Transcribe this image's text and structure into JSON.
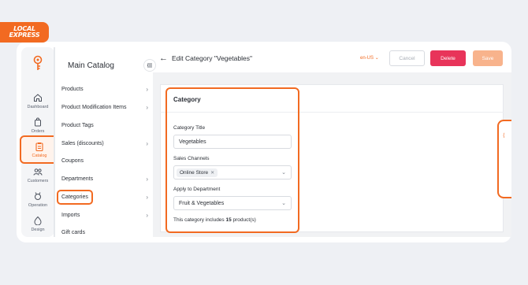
{
  "brand": {
    "name": "LOCAL EXPRESS",
    "color": "#f26a21"
  },
  "rail": {
    "items": [
      {
        "label": "Dashboard",
        "icon": "home-icon"
      },
      {
        "label": "Orders",
        "icon": "bag-icon"
      },
      {
        "label": "Catalog",
        "icon": "clipboard-icon",
        "active": true
      },
      {
        "label": "Customers",
        "icon": "users-icon"
      },
      {
        "label": "Operation",
        "icon": "operation-icon"
      },
      {
        "label": "Design",
        "icon": "design-icon"
      }
    ]
  },
  "submenu": {
    "title": "Main Catalog",
    "items": [
      {
        "label": "Products",
        "chevron": true
      },
      {
        "label": "Product Modification Items",
        "chevron": true
      },
      {
        "label": "Product Tags",
        "chevron": false
      },
      {
        "label": "Sales (discounts)",
        "chevron": true
      },
      {
        "label": "Coupons",
        "chevron": false
      },
      {
        "label": "Departments",
        "chevron": true
      },
      {
        "label": "Categories",
        "chevron": true,
        "active": true
      },
      {
        "label": "Imports",
        "chevron": true
      },
      {
        "label": "Gift cards",
        "chevron": false
      }
    ]
  },
  "header": {
    "title": "Edit Category \"Vegetables\"",
    "locale": "en-US",
    "cancel_label": "Cancel",
    "delete_label": "Delete",
    "save_label": "Save"
  },
  "form": {
    "section_title": "Category",
    "title_label": "Category Title",
    "title_value": "Vegetables",
    "channels_label": "Sales Channels",
    "channels": [
      "Online Store"
    ],
    "department_label": "Apply to Department",
    "department_value": "Fruit & Vegetables",
    "note_prefix": "This category includes",
    "note_count": "15",
    "note_suffix": "product(s)"
  },
  "colors": {
    "accent": "#f26a21",
    "delete": "#e8345a",
    "save_disabled": "#f8b38c"
  }
}
